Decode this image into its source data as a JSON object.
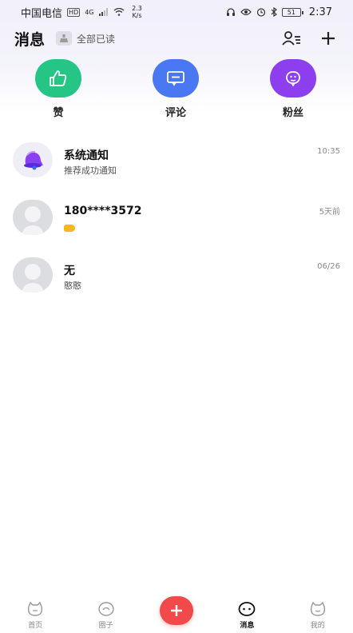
{
  "status_bar": {
    "carrier": "中国电信",
    "hd_tag": "HD",
    "signal_tag": "4G",
    "net_speed": "2.3\nK/s",
    "battery": "51",
    "time": "2:37"
  },
  "header": {
    "title": "消息",
    "mark_all_read": "全部已读"
  },
  "shortcuts": [
    {
      "label": "赞",
      "color": "#25c685",
      "icon": "thumbs-up-icon"
    },
    {
      "label": "评论",
      "color": "#4a78f2",
      "icon": "comment-icon"
    },
    {
      "label": "粉丝",
      "color": "#8d3ff0",
      "icon": "fans-face-icon"
    }
  ],
  "messages": [
    {
      "title": "系统通知",
      "subtitle": "推荐成功通知",
      "time": "10:35",
      "avatar": "bell-icon"
    },
    {
      "title": "180****3572",
      "subtitle": "",
      "time": "5天前",
      "avatar": "default-avatar-icon"
    },
    {
      "title": "无",
      "subtitle": "憨憨",
      "time": "06/26",
      "avatar": "default-avatar-icon"
    }
  ],
  "bottom_nav": [
    {
      "label": "首页",
      "icon": "home-icon"
    },
    {
      "label": "圈子",
      "icon": "circle-icon"
    },
    {
      "label": "",
      "icon": "plus-icon"
    },
    {
      "label": "消息",
      "icon": "message-icon",
      "active": true
    },
    {
      "label": "我的",
      "icon": "profile-icon"
    }
  ]
}
